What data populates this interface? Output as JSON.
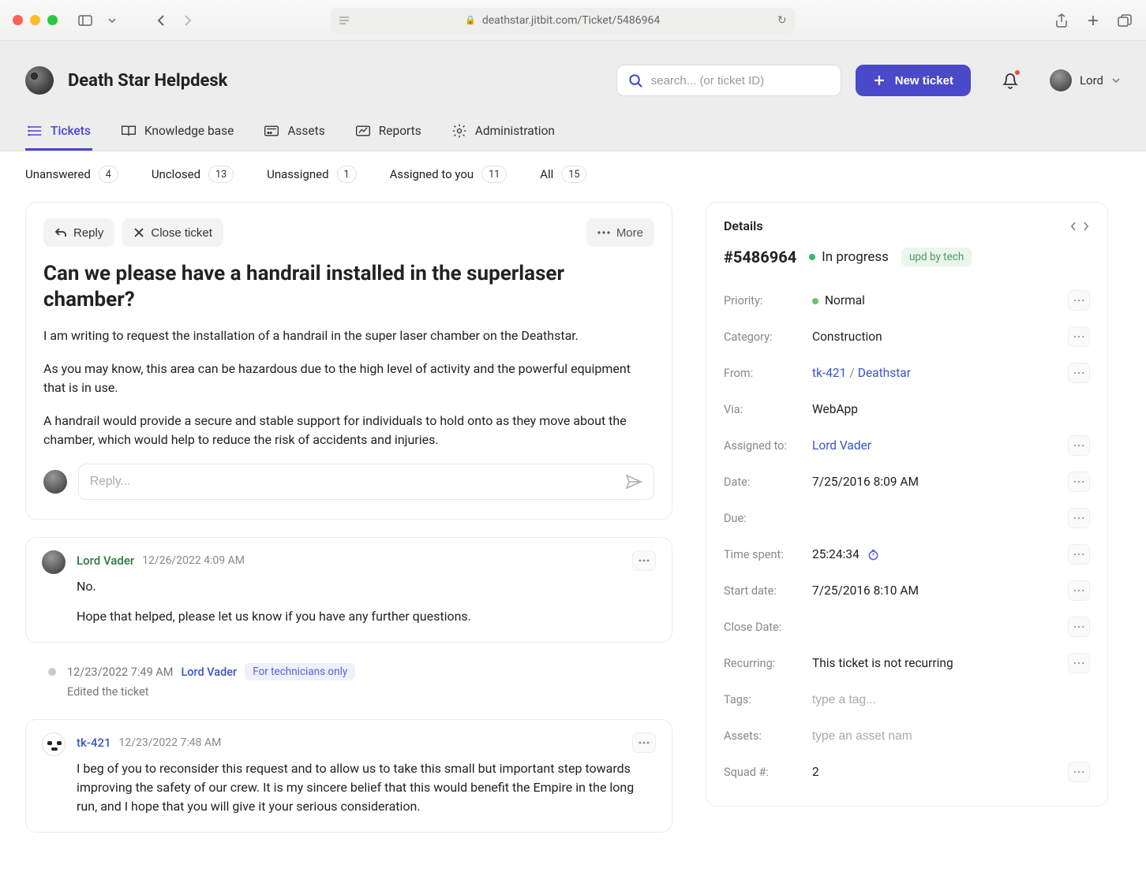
{
  "browser": {
    "url": "deathstar.jitbit.com/Ticket/5486964"
  },
  "header": {
    "title": "Death Star Helpdesk",
    "search_placeholder": "search... (or ticket ID)",
    "new_ticket_label": "New ticket",
    "user_name": "Lord"
  },
  "tabs": [
    {
      "label": "Tickets"
    },
    {
      "label": "Knowledge base"
    },
    {
      "label": "Assets"
    },
    {
      "label": "Reports"
    },
    {
      "label": "Administration"
    }
  ],
  "filters": [
    {
      "label": "Unanswered",
      "count": "4"
    },
    {
      "label": "Unclosed",
      "count": "13"
    },
    {
      "label": "Unassigned",
      "count": "1"
    },
    {
      "label": "Assigned to you",
      "count": "11"
    },
    {
      "label": "All",
      "count": "15"
    }
  ],
  "ticket": {
    "reply_label": "Reply",
    "close_label": "Close ticket",
    "more_label": "More",
    "title": "Can we please have a handrail installed in the superlaser chamber?",
    "p1": "I am writing to request the installation of a handrail in the super laser chamber on the Deathstar.",
    "p2": "As you may know, this area can be hazardous due to the high level of activity and the powerful equipment that is in use.",
    "p3": "A handrail would provide a secure and stable support for individuals to hold onto as they move about the chamber, which would help to reduce the risk of accidents and injuries.",
    "reply_placeholder": "Reply..."
  },
  "comments": [
    {
      "author": "Lord Vader",
      "ts": "12/26/2022 4:09 AM",
      "p1": "No.",
      "p2": "Hope that helped, please let us know if you have any further questions."
    }
  ],
  "log": {
    "ts": "12/23/2022 7:49 AM",
    "author": "Lord Vader",
    "badge": "For technicians only",
    "sub": "Edited the ticket"
  },
  "comment2": {
    "author": "tk-421",
    "ts": "12/23/2022 7:48 AM",
    "p1": "I beg of you to reconsider this request and to allow us to take this small but important step towards improving the safety of our crew. It is my sincere belief that this would benefit the Empire in the long run, and I hope that you will give it your serious consideration."
  },
  "details": {
    "heading": "Details",
    "id": "#5486964",
    "status": "In progress",
    "chip": "upd by tech",
    "fields": {
      "priority_l": "Priority:",
      "priority_v": "Normal",
      "category_l": "Category:",
      "category_v": "Construction",
      "from_l": "From:",
      "from_user": "tk-421",
      "from_org": "Deathstar",
      "via_l": "Via:",
      "via_v": "WebApp",
      "assigned_l": "Assigned to:",
      "assigned_v": "Lord Vader",
      "date_l": "Date:",
      "date_v": "7/25/2016 8:09 AM",
      "due_l": "Due:",
      "due_v": "",
      "time_l": "Time spent:",
      "time_v": "25:24:34",
      "start_l": "Start date:",
      "start_v": "7/25/2016 8:10 AM",
      "close_l": "Close Date:",
      "close_v": "",
      "recurring_l": "Recurring:",
      "recurring_v": "This ticket is not recurring",
      "tags_l": "Tags:",
      "tags_ph": "type a tag...",
      "assets_l": "Assets:",
      "assets_ph": "type an asset nam",
      "squad_l": "Squad #:",
      "squad_v": "2"
    }
  }
}
